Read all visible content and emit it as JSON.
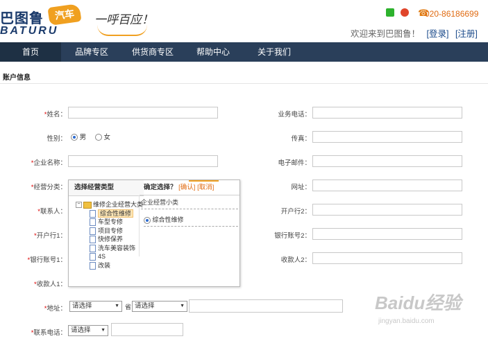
{
  "header": {
    "logo_cn": "巴图鲁",
    "logo_badge": "汽车",
    "logo_en": "BATURU",
    "slogan": "一呼百应！",
    "phone": "020-86186699",
    "welcome": "欢迎来到巴图鲁！",
    "login": "[登录]",
    "register": "[注册]"
  },
  "nav": {
    "items": [
      "首页",
      "品牌专区",
      "供货商专区",
      "帮助中心",
      "关于我们"
    ],
    "active": 0
  },
  "section_title": "账户信息",
  "form": {
    "left": {
      "name": "*姓名：",
      "gender": "性别：",
      "gender_male": "男",
      "gender_female": "女",
      "company": "*企业名称：",
      "category": "*经营分类：",
      "contact": "*联系人：",
      "bank1": "*开户行1：",
      "account1": "*银行账号1：",
      "payee1": "*收款人1：",
      "address": "*地址：",
      "phone": "*联系电话："
    },
    "right": {
      "work_phone": "业务电话：",
      "fax": "传真：",
      "email": "电子邮件：",
      "website": "网址：",
      "bank2": "开户行2：",
      "account2": "银行账号2：",
      "payee2": "收款人2："
    },
    "select_placeholder": "请选择",
    "province_suffix": "省"
  },
  "popup": {
    "left_title": "选择经营类型",
    "right_title": "确定选择？",
    "confirm": "[确认]",
    "cancel": "[取消]",
    "tree_root": "维修企业经营大类",
    "tree_items": [
      "综合性维修",
      "车型专修",
      "项目专修",
      "快修保养",
      "洗车美容装饰",
      "4S",
      "改装"
    ],
    "selected_item": 0,
    "sub_title": "企业经营小类",
    "sub_option": "综合性维修"
  },
  "watermark": {
    "brand": "Baidu经验",
    "url": "jingyan.baidu.com"
  },
  "colors": {
    "nav_bg": "#2a3f5a",
    "brand_blue": "#1a3a6b",
    "accent_orange": "#f0a020",
    "required_red": "#d00"
  }
}
